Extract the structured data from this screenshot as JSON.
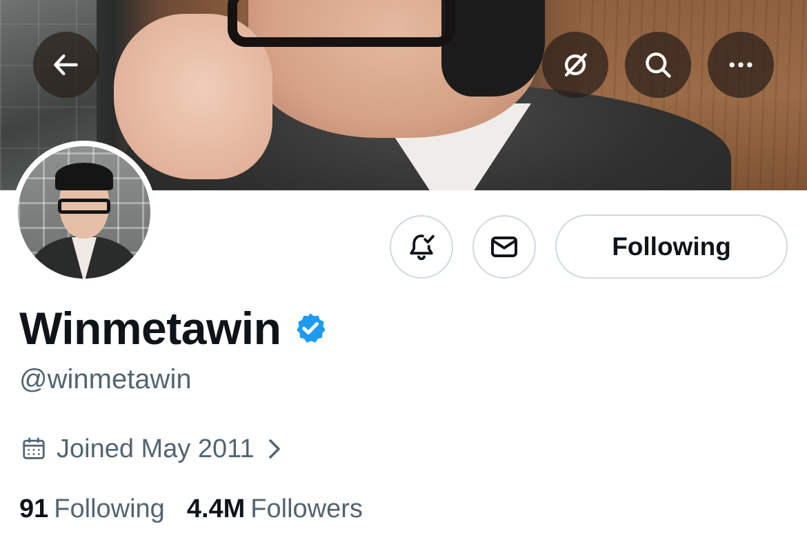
{
  "profile": {
    "display_name": "Winmetawin",
    "handle": "@winmetawin",
    "verified": true,
    "joined": "Joined May 2011",
    "stats": {
      "following_count": "91",
      "following_label": "Following",
      "followers_count": "4.4M",
      "followers_label": "Followers"
    }
  },
  "actions": {
    "follow_state_label": "Following"
  },
  "icons": {
    "back": "arrow-left-icon",
    "translate": "slashed-circle-icon",
    "search": "search-icon",
    "more": "more-horizontal-icon",
    "notifications": "bell-check-icon",
    "message": "envelope-icon",
    "verified": "verified-badge-icon",
    "calendar": "calendar-icon",
    "chevron": "chevron-right-icon"
  },
  "colors": {
    "text_primary": "#0f1419",
    "text_secondary": "#536471",
    "border": "#cfd9de",
    "verified_blue": "#1d9bf0"
  }
}
